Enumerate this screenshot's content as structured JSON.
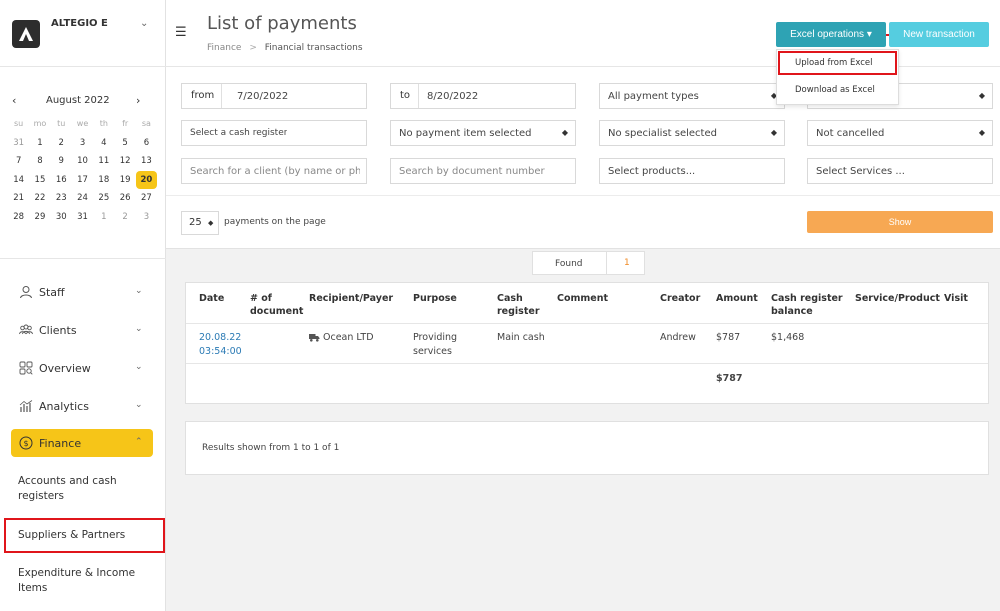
{
  "brand": {
    "name": "ALTEGIO E"
  },
  "calendar": {
    "month": "August 2022",
    "weekdays": [
      "su",
      "mo",
      "tu",
      "we",
      "th",
      "fr",
      "sa"
    ],
    "weeks": [
      [
        "31",
        "1",
        "2",
        "3",
        "4",
        "5",
        "6"
      ],
      [
        "7",
        "8",
        "9",
        "10",
        "11",
        "12",
        "13"
      ],
      [
        "14",
        "15",
        "16",
        "17",
        "18",
        "19",
        "20"
      ],
      [
        "21",
        "22",
        "23",
        "24",
        "25",
        "26",
        "27"
      ],
      [
        "28",
        "29",
        "30",
        "31",
        "1",
        "2",
        "3"
      ]
    ],
    "selected": "20"
  },
  "nav": {
    "staff": "Staff",
    "clients": "Clients",
    "overview": "Overview",
    "analytics": "Analytics",
    "finance": "Finance",
    "sub": {
      "accounts": "Accounts and cash registers",
      "suppliers": "Suppliers & Partners",
      "expenditure": "Expenditure & Income Items"
    }
  },
  "header": {
    "title": "List of payments",
    "crumb_root": "Finance",
    "crumb_sep": ">",
    "crumb_current": "Financial transactions",
    "excel_button": "Excel operations ▾",
    "new_button": "New transaction"
  },
  "dropdown": {
    "upload": "Upload from Excel",
    "download": "Download as Excel"
  },
  "filters": {
    "from_label": "from",
    "from_value": "7/20/2022",
    "to_label": "to",
    "to_value": "8/20/2022",
    "payment_types": "All payment types",
    "cash_register": "Select a cash register",
    "payment_item": "No payment item selected",
    "specialist": "No specialist selected",
    "cancelled": "Not cancelled",
    "client_search": "Search for a client (by name or phone)",
    "doc_search": "Search by document number",
    "products": "Select products...",
    "services": "Select Services ..."
  },
  "pager": {
    "size": "25",
    "label": "payments on the page",
    "show_button": "Show"
  },
  "found": {
    "label": "Found",
    "count": "1"
  },
  "table": {
    "headers": {
      "date": "Date",
      "doc": "# of document",
      "recipient": "Recipient/Payer",
      "purpose": "Purpose",
      "cash_register": "Cash register",
      "comment": "Comment",
      "creator": "Creator",
      "amount": "Amount",
      "balance": "Cash register balance",
      "service": "Service/Product",
      "visit": "Visit"
    },
    "row": {
      "date": "20.08.22",
      "time": "03:54:00",
      "recipient": "Ocean LTD",
      "purpose_line1": "Providing",
      "purpose_line2": "services",
      "cash_register": "Main cash",
      "creator": "Andrew",
      "amount": "$787",
      "balance": "$1,468"
    },
    "total": "$787"
  },
  "results": {
    "text": "Results shown from 1 to 1 of 1"
  },
  "colors": {
    "accent_yellow": "#f6c518",
    "excel_button": "#2ea3b4",
    "new_button": "#55cde0",
    "show_button": "#f7a853",
    "highlight_red": "#e0151b",
    "link_blue": "#2c7bb5"
  }
}
